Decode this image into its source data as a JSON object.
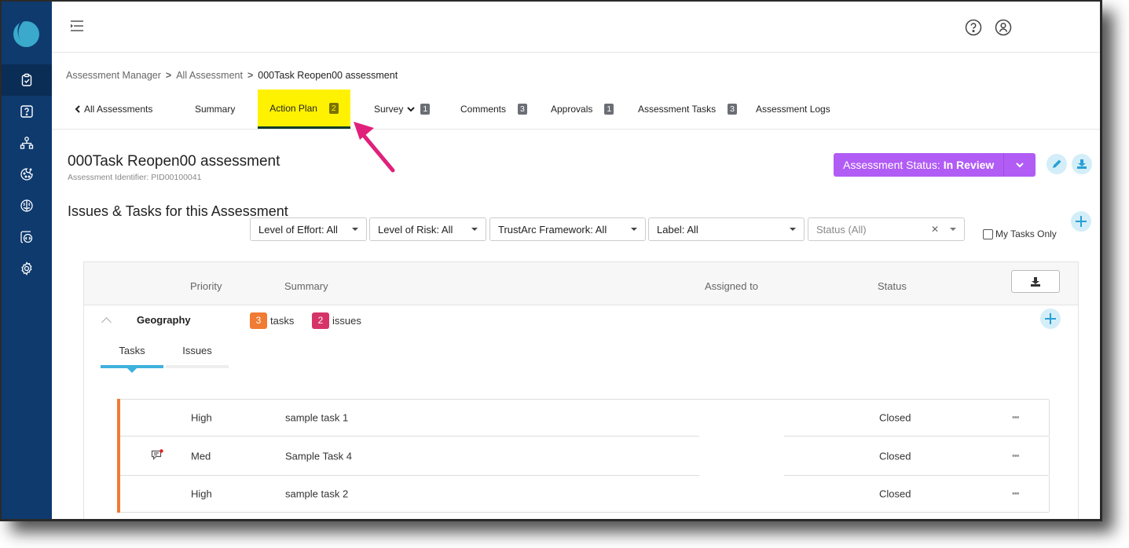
{
  "sidebar": {
    "logo": "trustarc-logo",
    "items": [
      {
        "icon": "clipboard-check-icon",
        "active": true
      },
      {
        "icon": "question-square-icon"
      },
      {
        "icon": "network-icon"
      },
      {
        "icon": "cookie-icon"
      },
      {
        "icon": "brain-icon"
      },
      {
        "icon": "code-window-icon"
      },
      {
        "icon": "gear-icon"
      }
    ]
  },
  "topbar": {
    "menu_icon": "menu-collapse-icon",
    "help_icon": "help-circle-icon",
    "user_icon": "user-circle-icon"
  },
  "breadcrumb": {
    "items": [
      "Assessment Manager",
      "All Assessment"
    ],
    "current": "000Task Reopen00 assessment",
    "separator": ">"
  },
  "tabs": {
    "back": "All Assessments",
    "items": [
      {
        "label": "Summary"
      },
      {
        "label": "Action Plan",
        "badge": "2",
        "active": true
      },
      {
        "label": "Survey",
        "badge": "1"
      },
      {
        "label": "Comments",
        "badge": "3"
      },
      {
        "label": "Approvals",
        "badge": "1"
      },
      {
        "label": "Assessment Tasks",
        "badge": "3"
      },
      {
        "label": "Assessment Logs"
      }
    ],
    "highlight_color": "#fff200",
    "annotation_arrow_color": "#e0207a"
  },
  "header": {
    "title": "000Task Reopen00 assessment",
    "identifier": "Assessment Identifier: PID00100041",
    "status_label": "Assessment Status:",
    "status_value": "In Review",
    "status_color": "#b15cf5"
  },
  "section": {
    "title": "Issues & Tasks for this Assessment"
  },
  "filters": {
    "effort": "Level of Effort: All",
    "risk": "Level of Risk: All",
    "framework": "TrustArc Framework: All",
    "label": "Label: All",
    "status_placeholder": "Status (All)",
    "my_tasks_only": "My Tasks Only"
  },
  "table": {
    "columns": {
      "priority": "Priority",
      "summary": "Summary",
      "assigned": "Assigned to",
      "status": "Status"
    },
    "group": {
      "name": "Geography",
      "tasks_count": "3",
      "tasks_label": "tasks",
      "issues_count": "2",
      "issues_label": "issues",
      "tasks_color": "#f07b32",
      "issues_color": "#d63369"
    },
    "subtabs": [
      "Tasks",
      "Issues"
    ],
    "rows": [
      {
        "priority": "High",
        "summary": "sample task 1",
        "assigned": "",
        "status": "Closed",
        "has_comment": false
      },
      {
        "priority": "Med",
        "summary": "Sample Task 4",
        "assigned": "",
        "status": "Closed",
        "has_comment": true
      },
      {
        "priority": "High",
        "summary": "sample task 2",
        "assigned": "",
        "status": "Closed",
        "has_comment": false
      }
    ],
    "more_label": "•••"
  }
}
